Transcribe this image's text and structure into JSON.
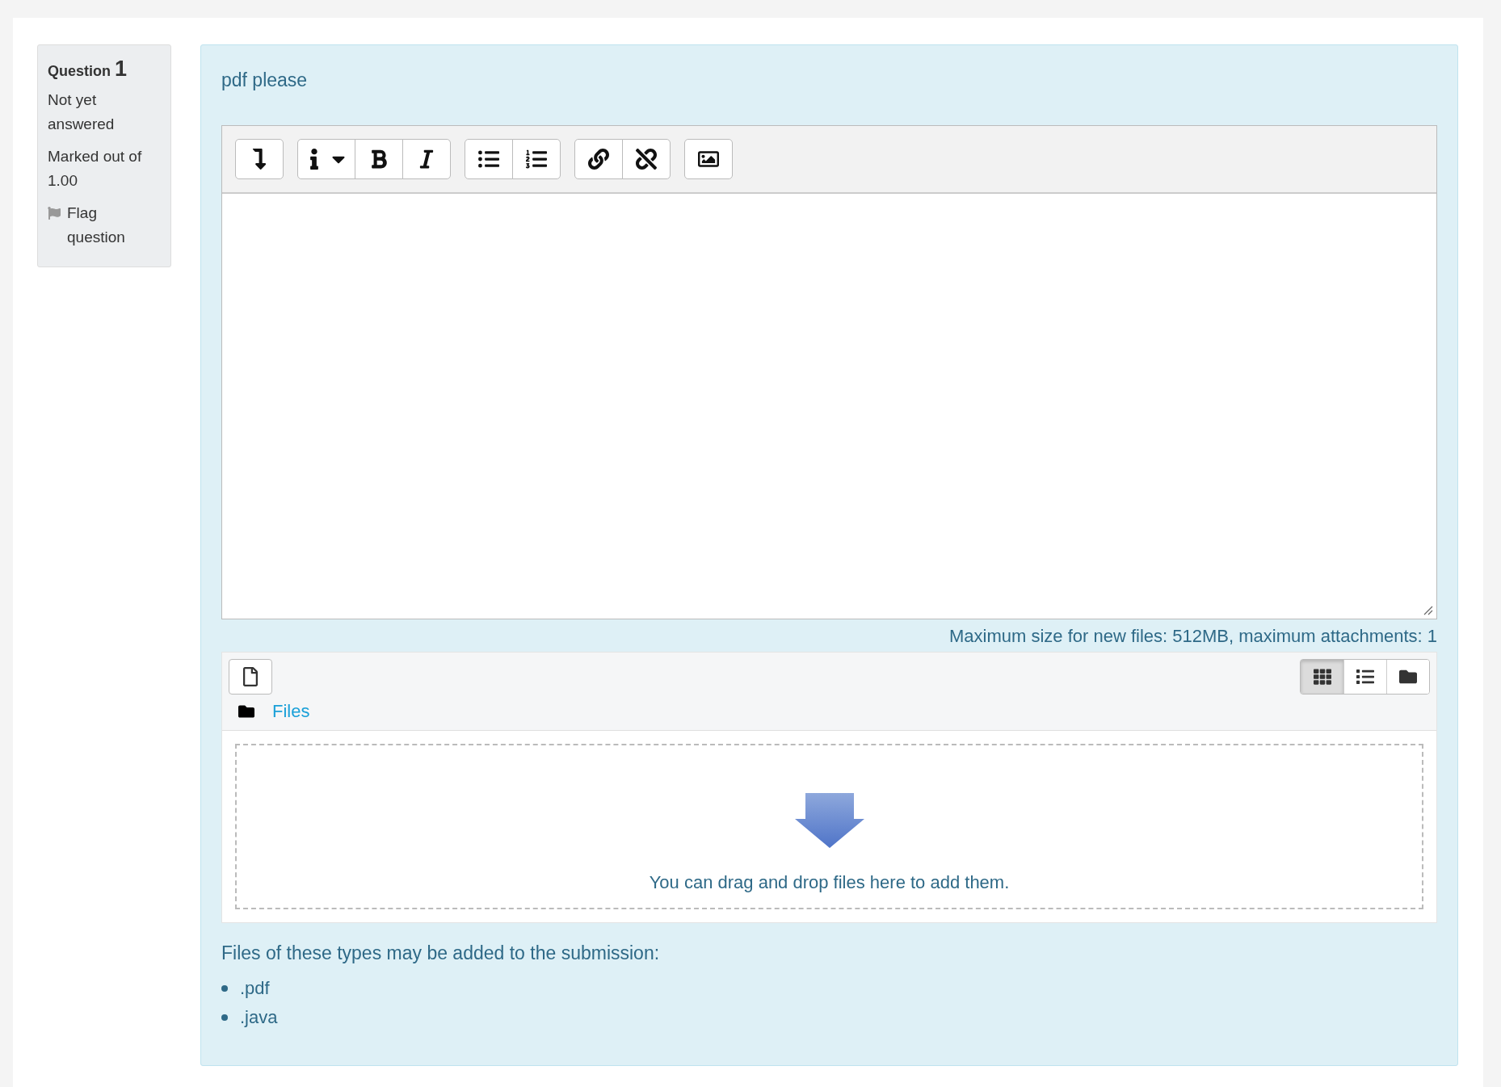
{
  "question_info": {
    "label": "Question",
    "number": "1",
    "state": "Not yet answered",
    "marks": "Marked out of 1.00",
    "flag": {
      "label": "Flag question",
      "flagged": false
    }
  },
  "prompt": "pdf please",
  "editor": {
    "toolbar": [
      [
        {
          "kind": "collapse"
        }
      ],
      [
        {
          "kind": "style"
        },
        {
          "kind": "bold"
        },
        {
          "kind": "italic"
        }
      ],
      [
        {
          "kind": "bullets"
        },
        {
          "kind": "numbers"
        }
      ],
      [
        {
          "kind": "link"
        },
        {
          "kind": "unlink"
        }
      ],
      [
        {
          "kind": "image"
        }
      ]
    ]
  },
  "file_limits": "Maximum size for new files: 512MB, maximum attachments: 1",
  "file_manager": {
    "view_modes": [
      {
        "kind": "icons",
        "selected": true
      },
      {
        "kind": "list",
        "selected": false
      },
      {
        "kind": "tree",
        "selected": false
      }
    ],
    "path": "Files",
    "drop_hint": "You can drag and drop files here to add them."
  },
  "accepted_types": {
    "label": "Files of these types may be added to the submission:",
    "types": [
      ".pdf",
      ".java"
    ]
  }
}
